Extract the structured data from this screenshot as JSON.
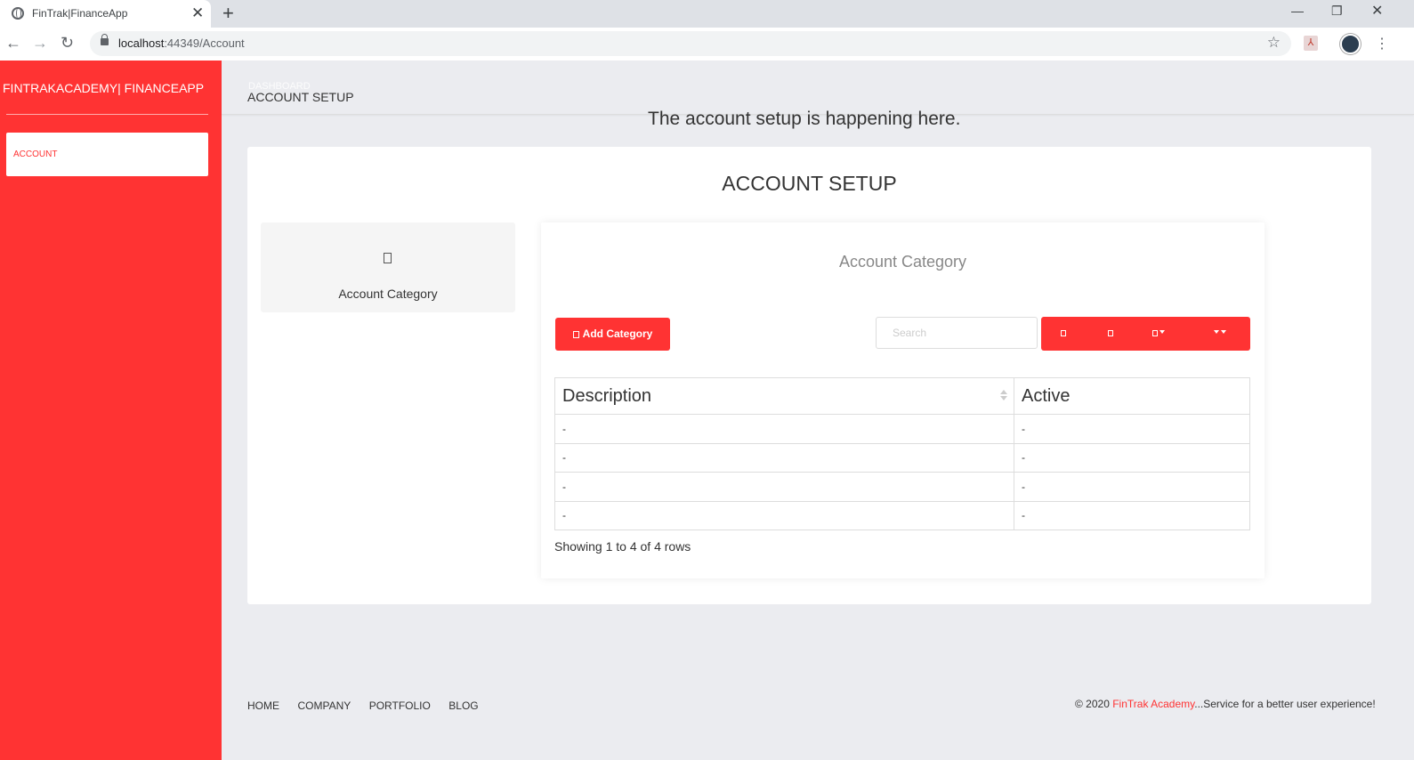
{
  "browser": {
    "tab_title": "FinTrak|FinanceApp",
    "url_host": "localhost",
    "url_path": ":44349/Account"
  },
  "sidebar": {
    "brand": "FINTRAKACADEMY| FINANCEAPP",
    "items": [
      {
        "label": "ACCOUNT"
      }
    ]
  },
  "topnav": {
    "breadcrumb_ghost": "DASHBOARD",
    "breadcrumb": "ACCOUNT SETUP"
  },
  "headline": "The account setup is happening here.",
  "card": {
    "title": "ACCOUNT SETUP",
    "tile_label": "Account Category"
  },
  "panel": {
    "title": "Account Category",
    "add_button": "Add Category",
    "search_placeholder": "Search",
    "table": {
      "columns": [
        "Description",
        "Active"
      ],
      "rows": [
        [
          "-",
          "-"
        ],
        [
          "-",
          "-"
        ],
        [
          "-",
          "-"
        ],
        [
          "-",
          "-"
        ]
      ]
    },
    "rows_info": "Showing 1 to 4 of 4 rows"
  },
  "footer": {
    "links": [
      "HOME",
      "COMPANY",
      "PORTFOLIO",
      "BLOG"
    ],
    "copyright_prefix": "© 2020 ",
    "copyright_brand": "FinTrak Academy",
    "copyright_suffix": "...Service for a better user experience!"
  },
  "colors": {
    "accent": "#ff3333",
    "background": "#ebecf0"
  }
}
